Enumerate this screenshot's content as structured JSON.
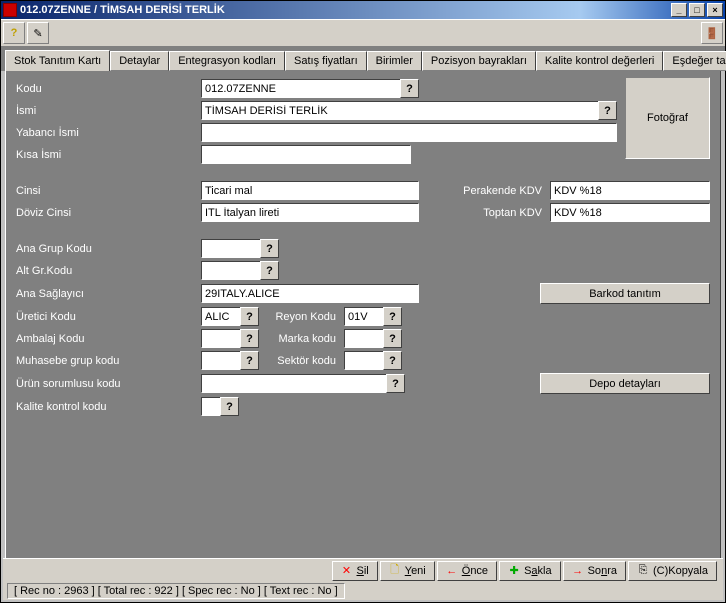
{
  "title": "012.07ZENNE / TİMSAH DERİSİ TERLİK",
  "tabs": [
    "Stok Tanıtım Kartı",
    "Detaylar",
    "Entegrasyon kodları",
    "Satış fiyatları",
    "Birimler",
    "Pozisyon bayrakları",
    "Kalite kontrol değerleri",
    "Eşdeğer tanımlamaları"
  ],
  "labels": {
    "kodu": "Kodu",
    "ismi": "İsmi",
    "yabanci": "Yabancı İsmi",
    "kisa": "Kısa İsmi",
    "cinsi": "Cinsi",
    "doviz": "Döviz Cinsi",
    "perakende": "Perakende KDV",
    "toptan": "Toptan KDV",
    "anagrup": "Ana Grup Kodu",
    "altgrup": "Alt Gr.Kodu",
    "saglayici": "Ana Sağlayıcı",
    "uretici": "Üretici Kodu",
    "reyon": "Reyon Kodu",
    "ambalaj": "Ambalaj Kodu",
    "marka": "Marka kodu",
    "muhasebe": "Muhasebe grup kodu",
    "sektor": "Sektör kodu",
    "urunsorumlusu": "Ürün sorumlusu kodu",
    "kalite": "Kalite kontrol kodu",
    "fotograf": "Fotoğraf"
  },
  "values": {
    "kodu": "012.07ZENNE",
    "ismi": "TİMSAH DERİSİ TERLİK",
    "yabanci": "",
    "kisa": "",
    "cinsi": "Ticari mal",
    "doviz": "ITL İtalyan lireti",
    "perakende": "KDV %18",
    "toptan": "KDV %18",
    "anagrup": "",
    "altgrup": "",
    "saglayici": "29ITALY.ALICE",
    "uretici": "ALIC",
    "reyon": "01V",
    "ambalaj": "",
    "marka": "",
    "muhasebe": "",
    "sektor": "",
    "urunsorumlusu": "",
    "kalite": ""
  },
  "buttons": {
    "barkod": "Barkod tanıtım",
    "depo": "Depo detayları",
    "sil": "Sil",
    "yeni": "Yeni",
    "once": "Önce",
    "sakla": "Sakla",
    "sonra": "Sonra",
    "kopyala": "(C)Kopyala"
  },
  "status": "[ Rec no :   2963 ] [ Total rec :    922 ] [ Spec rec : No ] [ Text rec : No ]"
}
